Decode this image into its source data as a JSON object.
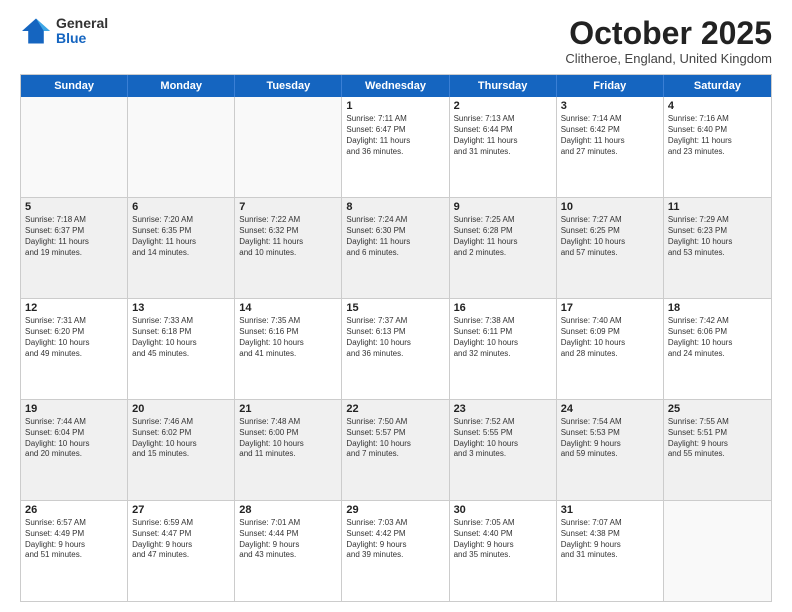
{
  "logo": {
    "general": "General",
    "blue": "Blue"
  },
  "title": "October 2025",
  "subtitle": "Clitheroe, England, United Kingdom",
  "days_of_week": [
    "Sunday",
    "Monday",
    "Tuesday",
    "Wednesday",
    "Thursday",
    "Friday",
    "Saturday"
  ],
  "weeks": [
    [
      {
        "day": "",
        "info": "",
        "empty": true
      },
      {
        "day": "",
        "info": "",
        "empty": true
      },
      {
        "day": "",
        "info": "",
        "empty": true
      },
      {
        "day": "1",
        "info": "Sunrise: 7:11 AM\nSunset: 6:47 PM\nDaylight: 11 hours\nand 36 minutes."
      },
      {
        "day": "2",
        "info": "Sunrise: 7:13 AM\nSunset: 6:44 PM\nDaylight: 11 hours\nand 31 minutes."
      },
      {
        "day": "3",
        "info": "Sunrise: 7:14 AM\nSunset: 6:42 PM\nDaylight: 11 hours\nand 27 minutes."
      },
      {
        "day": "4",
        "info": "Sunrise: 7:16 AM\nSunset: 6:40 PM\nDaylight: 11 hours\nand 23 minutes."
      }
    ],
    [
      {
        "day": "5",
        "info": "Sunrise: 7:18 AM\nSunset: 6:37 PM\nDaylight: 11 hours\nand 19 minutes."
      },
      {
        "day": "6",
        "info": "Sunrise: 7:20 AM\nSunset: 6:35 PM\nDaylight: 11 hours\nand 14 minutes."
      },
      {
        "day": "7",
        "info": "Sunrise: 7:22 AM\nSunset: 6:32 PM\nDaylight: 11 hours\nand 10 minutes."
      },
      {
        "day": "8",
        "info": "Sunrise: 7:24 AM\nSunset: 6:30 PM\nDaylight: 11 hours\nand 6 minutes."
      },
      {
        "day": "9",
        "info": "Sunrise: 7:25 AM\nSunset: 6:28 PM\nDaylight: 11 hours\nand 2 minutes."
      },
      {
        "day": "10",
        "info": "Sunrise: 7:27 AM\nSunset: 6:25 PM\nDaylight: 10 hours\nand 57 minutes."
      },
      {
        "day": "11",
        "info": "Sunrise: 7:29 AM\nSunset: 6:23 PM\nDaylight: 10 hours\nand 53 minutes."
      }
    ],
    [
      {
        "day": "12",
        "info": "Sunrise: 7:31 AM\nSunset: 6:20 PM\nDaylight: 10 hours\nand 49 minutes."
      },
      {
        "day": "13",
        "info": "Sunrise: 7:33 AM\nSunset: 6:18 PM\nDaylight: 10 hours\nand 45 minutes."
      },
      {
        "day": "14",
        "info": "Sunrise: 7:35 AM\nSunset: 6:16 PM\nDaylight: 10 hours\nand 41 minutes."
      },
      {
        "day": "15",
        "info": "Sunrise: 7:37 AM\nSunset: 6:13 PM\nDaylight: 10 hours\nand 36 minutes."
      },
      {
        "day": "16",
        "info": "Sunrise: 7:38 AM\nSunset: 6:11 PM\nDaylight: 10 hours\nand 32 minutes."
      },
      {
        "day": "17",
        "info": "Sunrise: 7:40 AM\nSunset: 6:09 PM\nDaylight: 10 hours\nand 28 minutes."
      },
      {
        "day": "18",
        "info": "Sunrise: 7:42 AM\nSunset: 6:06 PM\nDaylight: 10 hours\nand 24 minutes."
      }
    ],
    [
      {
        "day": "19",
        "info": "Sunrise: 7:44 AM\nSunset: 6:04 PM\nDaylight: 10 hours\nand 20 minutes."
      },
      {
        "day": "20",
        "info": "Sunrise: 7:46 AM\nSunset: 6:02 PM\nDaylight: 10 hours\nand 15 minutes."
      },
      {
        "day": "21",
        "info": "Sunrise: 7:48 AM\nSunset: 6:00 PM\nDaylight: 10 hours\nand 11 minutes."
      },
      {
        "day": "22",
        "info": "Sunrise: 7:50 AM\nSunset: 5:57 PM\nDaylight: 10 hours\nand 7 minutes."
      },
      {
        "day": "23",
        "info": "Sunrise: 7:52 AM\nSunset: 5:55 PM\nDaylight: 10 hours\nand 3 minutes."
      },
      {
        "day": "24",
        "info": "Sunrise: 7:54 AM\nSunset: 5:53 PM\nDaylight: 9 hours\nand 59 minutes."
      },
      {
        "day": "25",
        "info": "Sunrise: 7:55 AM\nSunset: 5:51 PM\nDaylight: 9 hours\nand 55 minutes."
      }
    ],
    [
      {
        "day": "26",
        "info": "Sunrise: 6:57 AM\nSunset: 4:49 PM\nDaylight: 9 hours\nand 51 minutes."
      },
      {
        "day": "27",
        "info": "Sunrise: 6:59 AM\nSunset: 4:47 PM\nDaylight: 9 hours\nand 47 minutes."
      },
      {
        "day": "28",
        "info": "Sunrise: 7:01 AM\nSunset: 4:44 PM\nDaylight: 9 hours\nand 43 minutes."
      },
      {
        "day": "29",
        "info": "Sunrise: 7:03 AM\nSunset: 4:42 PM\nDaylight: 9 hours\nand 39 minutes."
      },
      {
        "day": "30",
        "info": "Sunrise: 7:05 AM\nSunset: 4:40 PM\nDaylight: 9 hours\nand 35 minutes."
      },
      {
        "day": "31",
        "info": "Sunrise: 7:07 AM\nSunset: 4:38 PM\nDaylight: 9 hours\nand 31 minutes."
      },
      {
        "day": "",
        "info": "",
        "empty": true
      }
    ]
  ]
}
